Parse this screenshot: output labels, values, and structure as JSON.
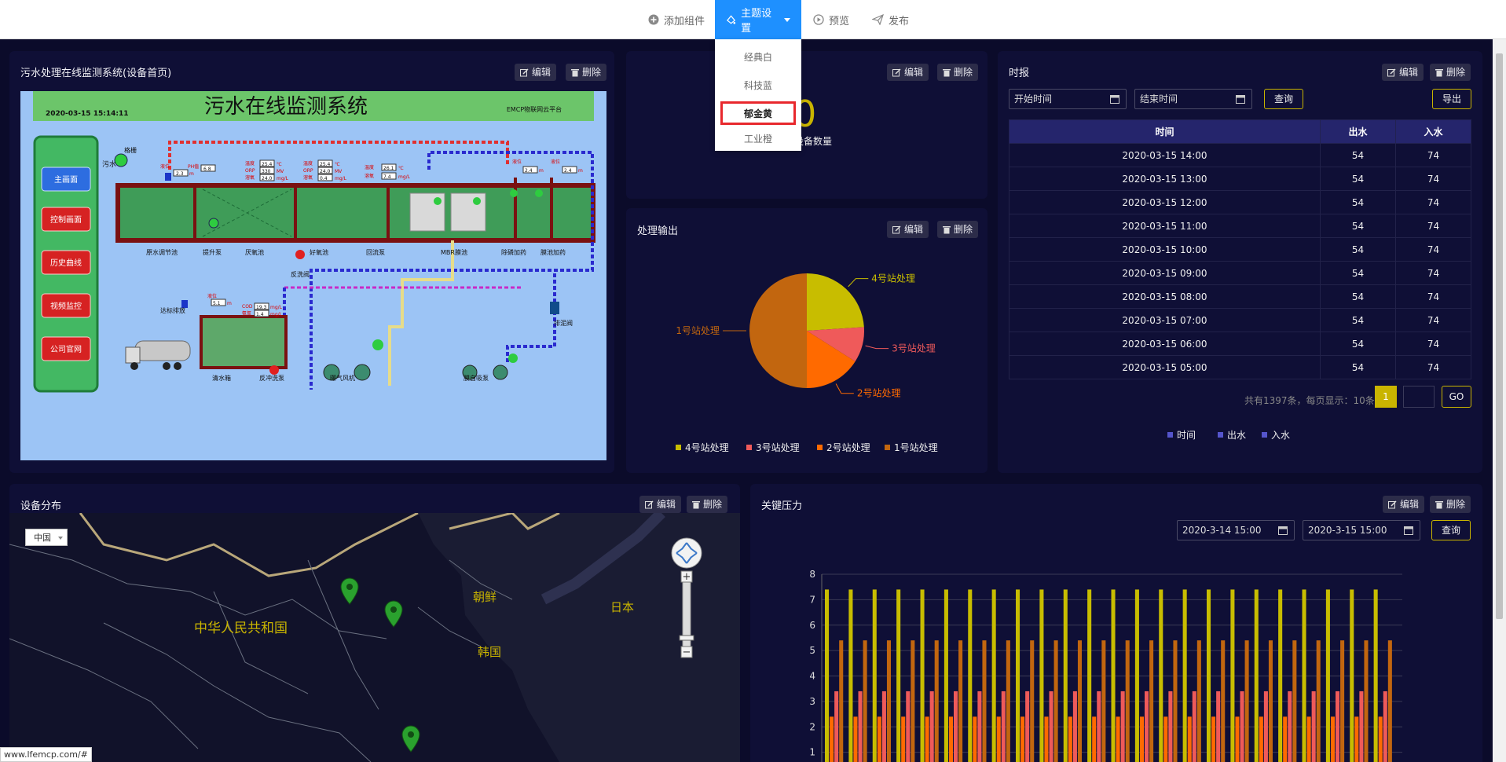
{
  "toolbar": {
    "add_widget": "添加组件",
    "theme_settings": "主题设置",
    "preview": "预览",
    "publish": "发布"
  },
  "theme_menu": {
    "items": [
      "经典白",
      "科技蓝",
      "郁金黄",
      "工业橙"
    ],
    "selected": "郁金黄"
  },
  "panel_buttons": {
    "edit": "编辑",
    "delete": "删除"
  },
  "scada": {
    "title": "污水处理在线监测系统(设备首页)",
    "banner_title": "污水在线监测系统",
    "date": "2020-03-15 15:14:11",
    "platform": "EMCP物联网云平台",
    "menu": [
      "主画面",
      "控制画面",
      "历史曲线",
      "视频监控",
      "公司官网"
    ],
    "labels": {
      "inlet": "污水",
      "screen": "格栅",
      "regulating_tank": "原水调节池",
      "lift_pump": "提升泵",
      "anoxic_tank": "厌氧池",
      "aerobic_tank": "好氧池",
      "reflux_pump": "回流泵",
      "mbr_tank": "MBR膜池",
      "phosphorus_dosing": "除磷加药",
      "membrane_dosing": "膜池加药",
      "backwash_valve": "反洗阀",
      "drain_valve": "排泥阀",
      "clean_tank": "清水箱",
      "backwash_pump": "反冲洗泵",
      "blower": "曝气风机",
      "membrane_pump": "膜自吸泵",
      "discharge": "达标排放",
      "level": "液位",
      "ph": "PH值",
      "temp": "温度",
      "orp": "ORP",
      "do": "溶氧",
      "cod": "COD",
      "nh3": "氨氮"
    },
    "readings": {
      "level1": "2.3",
      "ph": "6.8",
      "temp1": "25.4",
      "orp1": "330",
      "do1": "24.0",
      "temp2": "25.4",
      "orp2": "24.0",
      "do2": "0.4",
      "temp3": "26.1",
      "do3": "7.4",
      "level2": "2.4",
      "level3": "2.4",
      "level4": "5.1",
      "cod": "19.3",
      "nh3": "1.4"
    },
    "units": {
      "m": "m",
      "c": "℃",
      "mv": "MV",
      "mgl": "mg/L"
    }
  },
  "device_count": {
    "value": "0",
    "label": "设备数量"
  },
  "pie_panel": {
    "title": "处理输出",
    "legend": [
      {
        "name": "4号站处理",
        "color": "#c8bd00"
      },
      {
        "name": "3号站处理",
        "color": "#ef5a5a"
      },
      {
        "name": "2号站处理",
        "color": "#ff6a00"
      },
      {
        "name": "1号站处理",
        "color": "#c2660f"
      }
    ]
  },
  "chart_data": [
    {
      "type": "pie",
      "title": "处理输出",
      "labels": [
        "4号站处理",
        "3号站处理",
        "2号站处理",
        "1号站处理"
      ],
      "values": [
        24,
        10,
        16,
        50
      ],
      "colors": [
        "#c8bd00",
        "#ef5a5a",
        "#ff6a00",
        "#c2660f"
      ]
    },
    {
      "type": "bar",
      "title": "关键压力",
      "ylim": [
        0,
        8
      ],
      "yticks": [
        1,
        2,
        3,
        4,
        5,
        6,
        7,
        8
      ],
      "series_colors": [
        "#c8bd00",
        "#ff6a00",
        "#ef5a5a",
        "#c2660f"
      ],
      "group_values": [
        7.4,
        2.4,
        3.4,
        5.4
      ],
      "group_count": 24
    }
  ],
  "report": {
    "title": "时报",
    "start_placeholder": "开始时间",
    "end_placeholder": "结束时间",
    "query": "查询",
    "export": "导出",
    "columns": [
      "时间",
      "出水",
      "入水"
    ],
    "rows": [
      [
        "2020-03-15 14:00",
        "54",
        "74"
      ],
      [
        "2020-03-15 13:00",
        "54",
        "74"
      ],
      [
        "2020-03-15 12:00",
        "54",
        "74"
      ],
      [
        "2020-03-15 11:00",
        "54",
        "74"
      ],
      [
        "2020-03-15 10:00",
        "54",
        "74"
      ],
      [
        "2020-03-15 09:00",
        "54",
        "74"
      ],
      [
        "2020-03-15 08:00",
        "54",
        "74"
      ],
      [
        "2020-03-15 07:00",
        "54",
        "74"
      ],
      [
        "2020-03-15 06:00",
        "54",
        "74"
      ],
      [
        "2020-03-15 05:00",
        "54",
        "74"
      ]
    ],
    "pager_text": "共有1397条，每页显示：10条",
    "current_page": "1",
    "go": "GO",
    "legend": [
      "时间",
      "出水",
      "入水"
    ]
  },
  "map": {
    "title": "设备分布",
    "region_select": "中国",
    "labels": {
      "china": "中华人民共和国",
      "north_korea": "朝鲜",
      "south_korea": "韩国",
      "japan": "日本"
    },
    "zoom_in": "+",
    "zoom_out": "−"
  },
  "pressure": {
    "title": "关键压力",
    "start": "2020-3-14 15:00",
    "end": "2020-3-15 15:00",
    "query": "查询"
  },
  "status_url": "www.lfemcp.com/#"
}
